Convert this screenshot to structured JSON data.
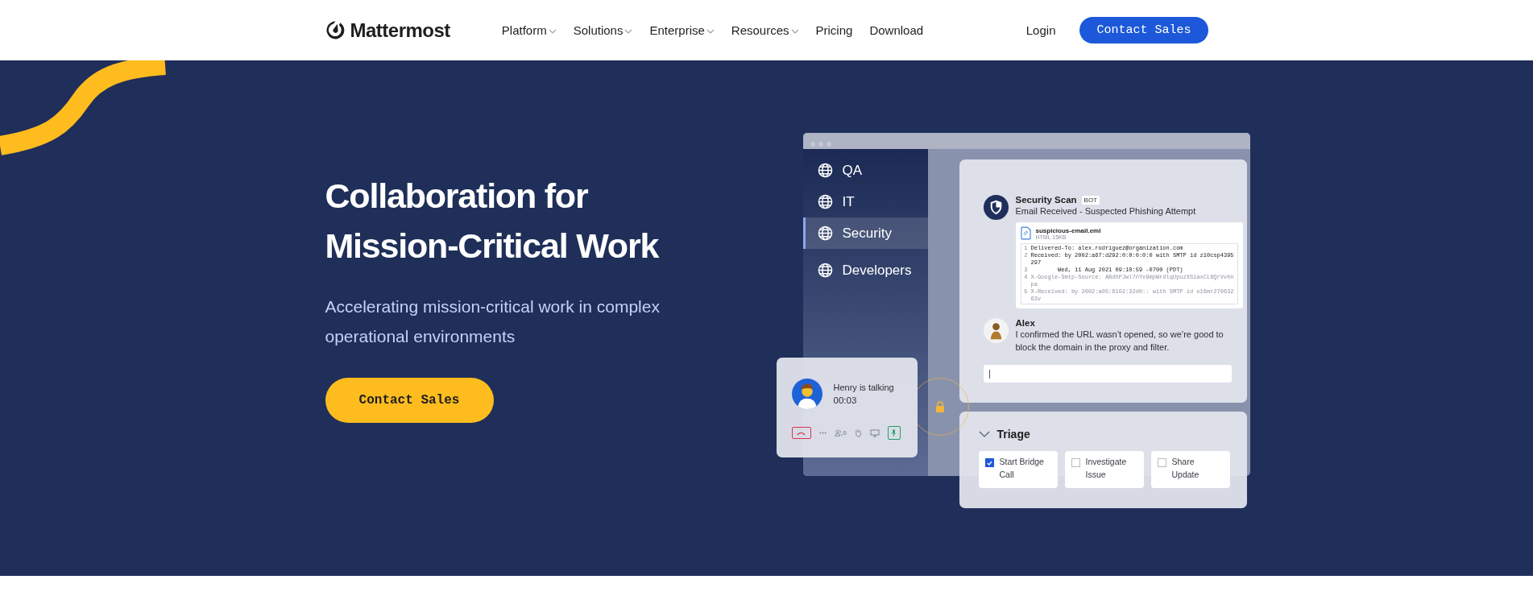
{
  "nav": {
    "logo": "Mattermost",
    "links": [
      {
        "label": "Platform",
        "dropdown": true
      },
      {
        "label": "Solutions",
        "dropdown": true
      },
      {
        "label": "Enterprise",
        "dropdown": true
      },
      {
        "label": "Resources",
        "dropdown": true
      },
      {
        "label": "Pricing",
        "dropdown": false
      },
      {
        "label": "Download",
        "dropdown": false
      }
    ],
    "login": "Login",
    "cta": "Contact Sales"
  },
  "hero": {
    "title_lines": [
      "Collaboration for",
      "Mission-Critical Work"
    ],
    "subtitle": "Accelerating mission-critical work in complex operational environments",
    "button": "Contact Sales"
  },
  "illustration": {
    "channels": [
      {
        "label": "QA",
        "selected": false
      },
      {
        "label": "IT",
        "selected": false
      },
      {
        "label": "Security",
        "selected": true
      },
      {
        "label": "Developers",
        "selected": false
      }
    ],
    "bot_post": {
      "author": "Security Scan",
      "badge": "BOT",
      "text": "Email Received - Suspected Phishing Attempt",
      "file": {
        "name": "suspicious-email.eml",
        "meta": "HTML 15KB"
      },
      "code_lines": [
        {
          "num": "1",
          "text": "Delivered-To: alex.rodriguez@organization.com",
          "faded": false
        },
        {
          "num": "2",
          "text": "Received: by 2002:a67:d292:0:0:0:0:0 with SMTP id z10csp4395297",
          "faded": false
        },
        {
          "num": "3",
          "text": "        Wed, 11 Aug 2021 09:10:59 -0700 (PDT)",
          "faded": false
        },
        {
          "num": "4",
          "text": "X-Google-Smtp-Source: ABdhPJwl7nYv9mpWrdlqUpuzXSiaxCL6QrVvhnpa",
          "faded": true
        },
        {
          "num": "5",
          "text": "X-Received: by 2002:a05:6102:32d0:: with SMTP id o16mr27063263v",
          "faded": true
        }
      ]
    },
    "reply": {
      "author": "Alex",
      "text": "I confirmed the URL wasn’t opened, so we’re good to block the domain in the proxy and filter."
    },
    "call": {
      "speaker": "Henry is talking",
      "time": "00:03",
      "participants": "6"
    },
    "triage": {
      "title": "Triage",
      "items": [
        {
          "label": "Start Bridge Call",
          "checked": true
        },
        {
          "label": "Investigate Issue",
          "checked": false
        },
        {
          "label": "Share Update",
          "checked": false
        }
      ]
    }
  }
}
